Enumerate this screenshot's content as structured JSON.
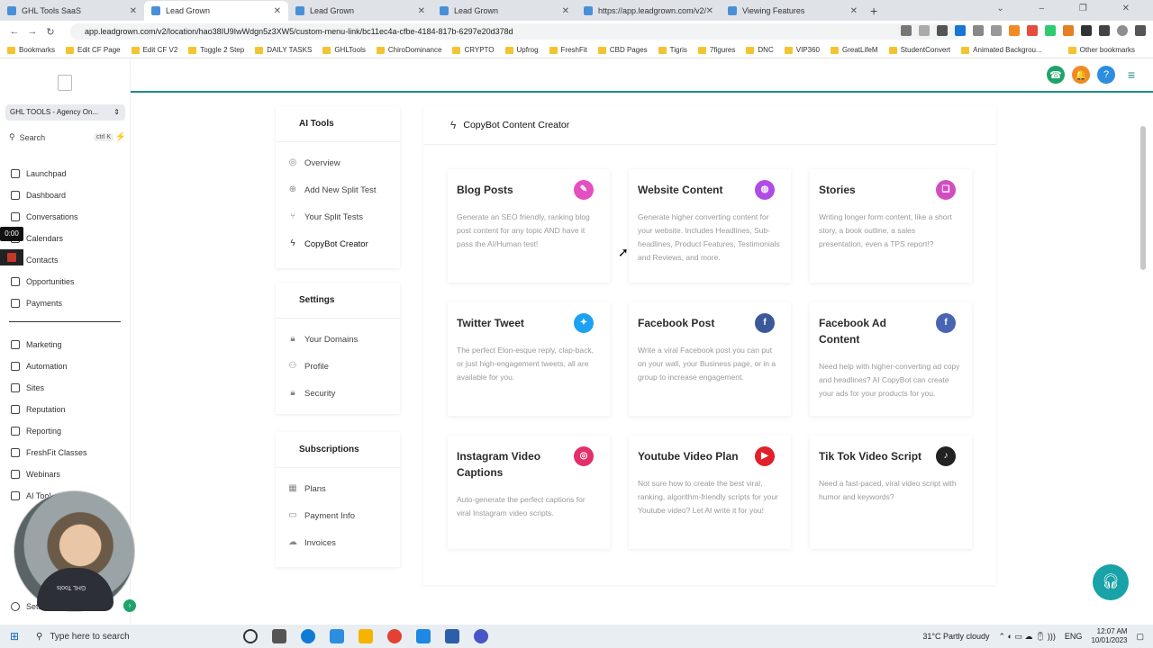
{
  "browser": {
    "tabs": [
      {
        "title": "GHL Tools SaaS",
        "active": false
      },
      {
        "title": "Lead Grown",
        "active": true
      },
      {
        "title": "Lead Grown",
        "active": false
      },
      {
        "title": "Lead Grown",
        "active": false
      },
      {
        "title": "https://app.leadgrown.com/v2/p",
        "active": false
      },
      {
        "title": "Viewing Features",
        "active": false
      }
    ],
    "url": "app.leadgrown.com/v2/location/hao38IU9IwWdgn5z3XW5/custom-menu-link/bc11ec4a-cfbe-4184-817b-6297e20d378d",
    "bookmarks": [
      "Bookmarks",
      "Edit CF Page",
      "Edit CF V2",
      "Toggle 2 Step",
      "DAILY TASKS",
      "GHLTools",
      "ChiroDominance",
      "CRYPTO",
      "Upfrog",
      "FreshFit",
      "CBD Pages",
      "Tigris",
      "7figures",
      "DNC",
      "VIP360",
      "GreatLifeM",
      "StudentConvert",
      "Animated Backgrou..."
    ],
    "other_bookmarks": "Other bookmarks"
  },
  "sidebar": {
    "agency": "GHL TOOLS - Agency On...",
    "search_label": "Search",
    "search_shortcut": "ctrl K",
    "items": [
      {
        "label": "Launchpad",
        "name": "launchpad"
      },
      {
        "label": "Dashboard",
        "name": "dashboard"
      },
      {
        "label": "Conversations",
        "name": "conversations"
      },
      {
        "label": "Calendars",
        "name": "calendars"
      },
      {
        "label": "Contacts",
        "name": "contacts"
      },
      {
        "label": "Opportunities",
        "name": "opportunities"
      },
      {
        "label": "Payments",
        "name": "payments"
      },
      {
        "label": "Marketing",
        "name": "marketing"
      },
      {
        "label": "Automation",
        "name": "automation"
      },
      {
        "label": "Sites",
        "name": "sites"
      },
      {
        "label": "Reputation",
        "name": "reputation"
      },
      {
        "label": "Reporting",
        "name": "reporting"
      },
      {
        "label": "FreshFit Classes",
        "name": "freshfit-classes"
      },
      {
        "label": "Webinars",
        "name": "webinars"
      },
      {
        "label": "AI Tool",
        "name": "ai-tool"
      }
    ],
    "settings_label": "Settin",
    "recording_time": "0:00",
    "webcam_shirt_text": "GHL Tools"
  },
  "menu": {
    "ai_tools_title": "AI Tools",
    "ai_tools_items": [
      "Overview",
      "Add New Split Test",
      "Your Split Tests",
      "CopyBot Creator"
    ],
    "settings_title": "Settings",
    "settings_items": [
      "Your Domains",
      "Profile",
      "Security"
    ],
    "subscriptions_title": "Subscriptions",
    "subscriptions_items": [
      "Plans",
      "Payment Info",
      "Invoices"
    ]
  },
  "panel": {
    "title": "CopyBot Content Creator",
    "cards": [
      {
        "title": "Blog Posts",
        "desc": "Generate an SEO friendly, ranking blog post content for any topic AND have it pass the AI/Human test!",
        "icon": "edit-icon",
        "color": "#e44fc1"
      },
      {
        "title": "Website Content",
        "desc": "Generate higher converting content for your website. Includes Headlines, Sub-headlines, Product Features, Testimonials and Reviews, and more.",
        "icon": "globe-icon",
        "color": "#b04ce6"
      },
      {
        "title": "Stories",
        "desc": "Writing longer form content, like a short story, a book outline, a sales presentation, even a TPS report!?",
        "icon": "bookmark-icon",
        "color": "#d24ec0"
      },
      {
        "title": "Twitter Tweet",
        "desc": "The perfect Elon-esque reply, clap-back, or just high-engagement tweets, all are available for you.",
        "icon": "twitter-icon",
        "color": "#1da1f2"
      },
      {
        "title": "Facebook Post",
        "desc": "Write a viral Facebook post you can put on your wall, your Business page, or in a group to increase engagement.",
        "icon": "facebook-icon",
        "color": "#3b5998"
      },
      {
        "title": "Facebook Ad Content",
        "desc": "Need help with higher-converting ad copy and headlines? AI CopyBot can create your ads for your products for you.",
        "icon": "facebook-icon",
        "color": "#4a64b4"
      },
      {
        "title": "Instagram Video Captions",
        "desc": "Auto-generate the perfect captions for viral Instagram video scripts.",
        "icon": "instagram-icon",
        "color": "#e1306c"
      },
      {
        "title": "Youtube Video Plan",
        "desc": "Not sure how to create the best viral, ranking, algorithm-friendly scripts for your Youtube video? Let AI write it for you!",
        "icon": "youtube-icon",
        "color": "#e0202a"
      },
      {
        "title": "Tik Tok Video Script",
        "desc": "Need a fast-paced, viral video script with humor and keywords?",
        "icon": "tiktok-icon",
        "color": "#222222"
      }
    ]
  },
  "taskbar": {
    "search_placeholder": "Type here to search",
    "weather": "31°C  Partly cloudy",
    "lang": "ENG",
    "time": "12:07 AM",
    "date": "10/01/2023"
  }
}
